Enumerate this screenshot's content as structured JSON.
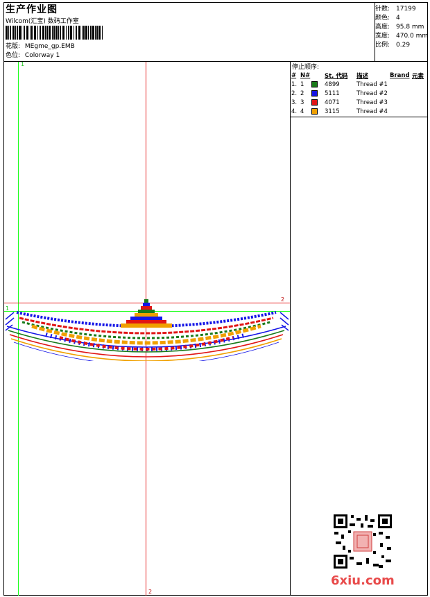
{
  "header": {
    "title": "生产作业图",
    "company": "Wilcom(汇宝) 数码工作室",
    "design_label": "花版:",
    "design_value": "MEgme_gp.EMB",
    "colorway_label": "色位:",
    "colorway_value": "Colorway 1"
  },
  "stats": [
    {
      "label": "针数:",
      "value": "17199"
    },
    {
      "label": "颜色:",
      "value": "4"
    },
    {
      "label": "高度:",
      "value": "95.8 mm"
    },
    {
      "label": "宽度:",
      "value": "470.0 mm"
    },
    {
      "label": "比例:",
      "value": "0.29"
    }
  ],
  "stop_sequence": {
    "title": "停止顺序:",
    "columns": [
      "#",
      "N#",
      "St. 代码",
      "描述",
      "Brand",
      "元素"
    ],
    "rows": [
      {
        "num": "1.",
        "n": "1",
        "color": "#1a7a1a",
        "code": "4899",
        "desc": "Thread #1"
      },
      {
        "num": "2.",
        "n": "2",
        "color": "#1515e6",
        "code": "5111",
        "desc": "Thread #2"
      },
      {
        "num": "3.",
        "n": "3",
        "color": "#e01515",
        "code": "4071",
        "desc": "Thread #3"
      },
      {
        "num": "4.",
        "n": "4",
        "color": "#f0a000",
        "code": "3115",
        "desc": "Thread #4"
      }
    ]
  },
  "markers": {
    "m1_top": "1",
    "m1_left": "1",
    "m2_right": "2",
    "m2_bottom": "2"
  },
  "watermark": "6xiu.com",
  "colors": {
    "green_guide": "#19ff19",
    "red_guide": "#e62020"
  }
}
